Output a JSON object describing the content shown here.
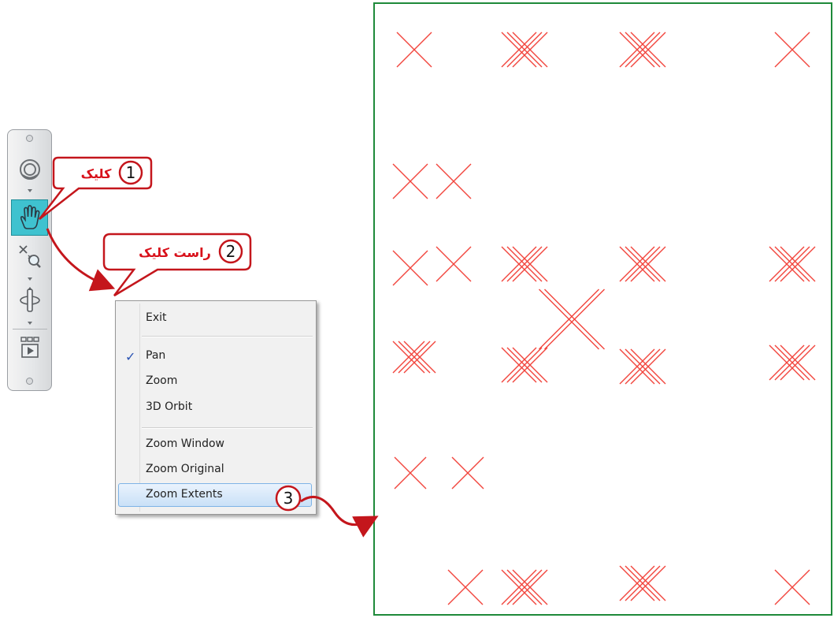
{
  "navigation_bar": {
    "tools": [
      {
        "name": "steering-wheel",
        "icon": "steering-wheel-icon"
      },
      {
        "name": "pan",
        "icon": "hand-icon",
        "active": true
      },
      {
        "name": "zoom",
        "icon": "zoom-icon"
      },
      {
        "name": "orbit",
        "icon": "orbit-icon"
      },
      {
        "name": "showmotion",
        "icon": "showmotion-icon"
      }
    ],
    "active_color": "#3fc2cf"
  },
  "callouts": [
    {
      "number": "1",
      "label": "کلیک"
    },
    {
      "number": "2",
      "label": "راست کلیک"
    },
    {
      "number": "3",
      "label": ""
    }
  ],
  "context_menu": {
    "items": [
      {
        "label": "Exit"
      },
      {
        "label": "Pan",
        "checked": true
      },
      {
        "label": "Zoom"
      },
      {
        "label": "3D Orbit"
      },
      {
        "label": "Zoom Window"
      },
      {
        "label": "Zoom Original"
      },
      {
        "label": "Zoom Extents",
        "highlighted": true
      }
    ],
    "check_mark": "✓"
  },
  "drawing": {
    "border_color": "#1e8a3a",
    "mark_color": "#f2453d"
  }
}
